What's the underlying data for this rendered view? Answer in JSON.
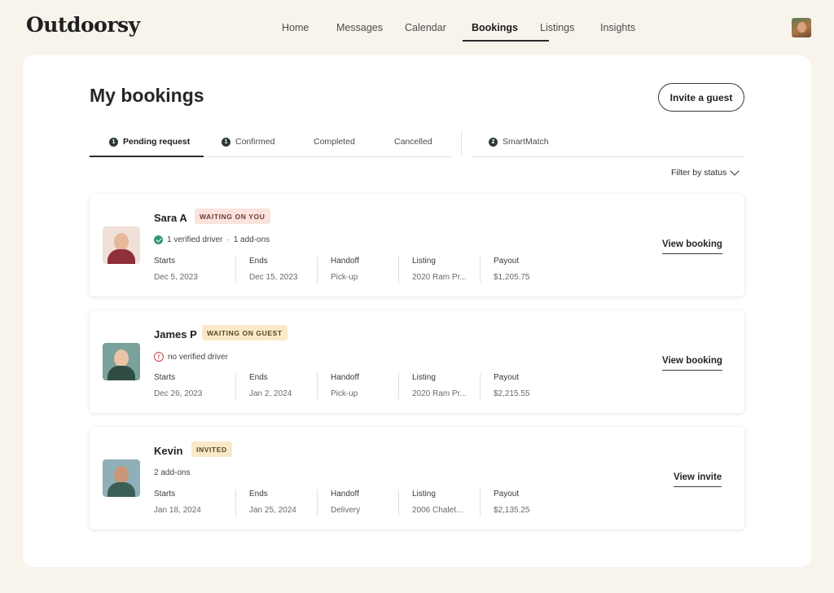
{
  "app": {
    "logo": "Outdoorsy"
  },
  "nav": {
    "items": [
      {
        "label": "Home"
      },
      {
        "label": "Messages"
      },
      {
        "label": "Calendar"
      },
      {
        "label": "Bookings",
        "active": true
      },
      {
        "label": "Listings"
      },
      {
        "label": "Insights"
      }
    ]
  },
  "page": {
    "title": "My bookings",
    "invite_label": "Invite a guest"
  },
  "tabs": [
    {
      "label": "Pending request",
      "count": "1",
      "active": true
    },
    {
      "label": "Confirmed",
      "count": "1"
    },
    {
      "label": "Completed",
      "count": ""
    },
    {
      "label": "Cancelled",
      "count": ""
    },
    {
      "label": "SmartMatch",
      "count": "2"
    }
  ],
  "filter": {
    "label": "Filter by status"
  },
  "field_labels": {
    "starts": "Starts",
    "ends": "Ends",
    "handoff": "Handoff",
    "listing": "Listing",
    "payout": "Payout"
  },
  "bookings": [
    {
      "name": "Sara A",
      "badge": "WAITING ON YOU",
      "badge_bg": "#fbe3dd",
      "badge_color": "#6b3a32",
      "meta_icon": "check",
      "meta_text": "1 verified driver",
      "meta_extra": "1 add-ons",
      "starts": "Dec 5, 2023",
      "ends": "Dec 15, 2023",
      "handoff": "Pick-up",
      "listing": "2020 Ram Pr...",
      "payout": "$1,205.75",
      "action": "View booking"
    },
    {
      "name": "James P",
      "badge": "WAITING ON GUEST",
      "badge_bg": "#f8e9c9",
      "badge_color": "#5a4520",
      "meta_icon": "warning",
      "meta_text": "no verified driver",
      "meta_extra": "",
      "starts": "Dec 26, 2023",
      "ends": "Jan 2, 2024",
      "handoff": "Pick-up",
      "listing": "2020 Ram Pr...",
      "payout": "$2,215.55",
      "action": "View booking"
    },
    {
      "name": "Kevin",
      "badge": "INVITED",
      "badge_bg": "#f8e9c9",
      "badge_color": "#5a4520",
      "meta_icon": "",
      "meta_text": "2 add-ons",
      "meta_extra": "",
      "starts": "Jan 18, 2024",
      "ends": "Jan 25, 2024",
      "handoff": "Delivery",
      "listing": "2006 Chalet...",
      "payout": "$2,135.25",
      "action": "View invite"
    }
  ]
}
